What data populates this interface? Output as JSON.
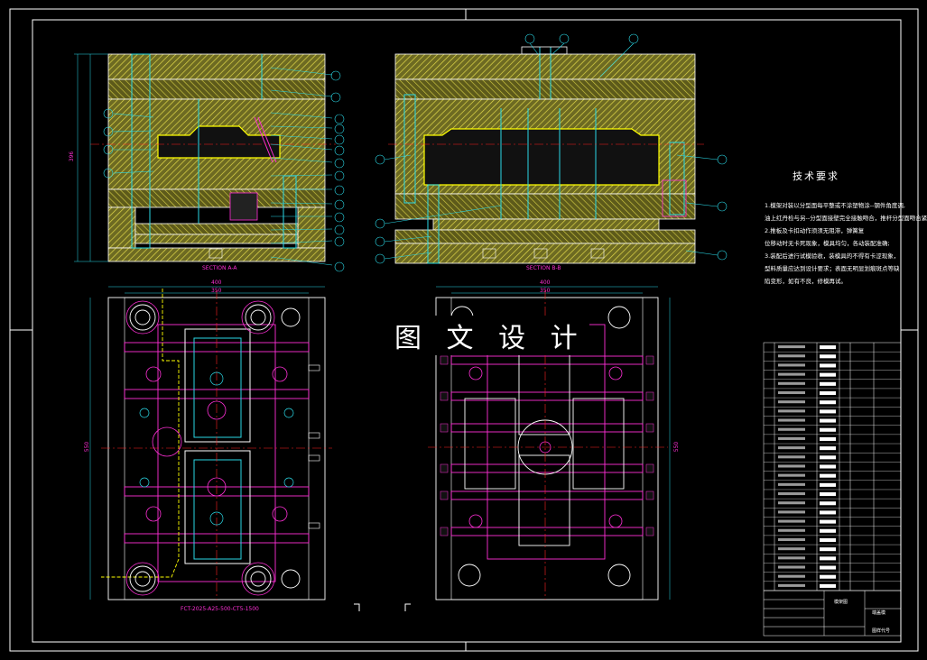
{
  "watermark": "图 文 设 计",
  "tech_requirements": {
    "title": "技术要求",
    "lines": [
      "1.模架对装以分型面每平整或不涂塑物涂--钢件角度调,",
      "油上红丹检与另--分型面接壁完全接触吻合，推杆分型面吻合紧尺;",
      "2.推板及卡扣动作须须无阻滞，弹簧复",
      "位移动时无卡死现象，模具均匀，各动装配准确;",
      "3.装配后进行试模验收，装模具的不得有卡涩现象，",
      "型料质量应达到设计要求；表面无明显划痕斑点等缺",
      "陷变形，如有不良，修模再试。"
    ]
  },
  "sections": {
    "a": "SECTION A-A",
    "b": "SECTION B-B"
  },
  "dims": {
    "a_top_1": "400",
    "a_top_2": "350",
    "b_top_1": "400",
    "b_top_2": "350",
    "a_side": "550",
    "b_side": "550",
    "a_height": "396",
    "bottom_code": "FCT-2025-A25-500-CT5-1500"
  },
  "title_block": {
    "drawing_name": "模架图",
    "part_name": "端盖模",
    "code_label": "图样代号"
  },
  "colors": {
    "frame": "#ffffff",
    "hatch": "#e0d84a",
    "cyan": "#2ad8e6",
    "magenta": "#ff2fd6",
    "red": "#ff2020",
    "yellow": "#ffff00",
    "blue": "#2b5bff"
  }
}
